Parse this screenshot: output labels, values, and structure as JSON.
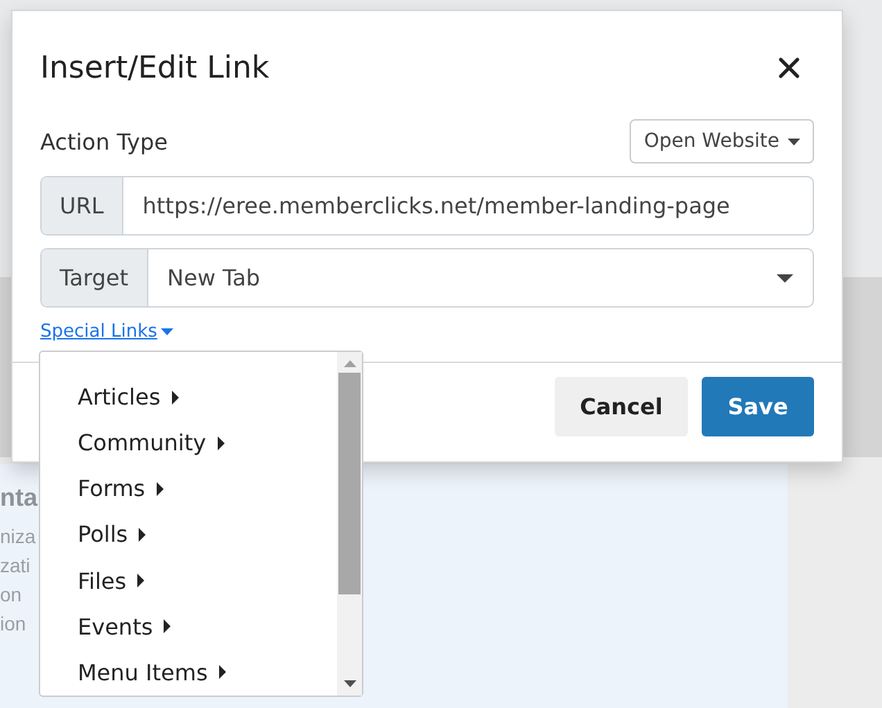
{
  "background": {
    "fragments": [
      "nta",
      "niza",
      "zati",
      "on",
      "ion"
    ]
  },
  "dialog": {
    "title": "Insert/Edit Link",
    "action_type": {
      "label": "Action Type",
      "value": "Open Website"
    },
    "url": {
      "addon": "URL",
      "value": "https://eree.memberclicks.net/member-landing-page"
    },
    "target": {
      "addon": "Target",
      "value": "New Tab"
    },
    "special_links": {
      "label": "Special Links",
      "expanded": true
    },
    "buttons": [
      {
        "label": "Cancel",
        "kind": "secondary"
      },
      {
        "label": "Save",
        "kind": "primary"
      }
    ]
  },
  "special_links_menu": {
    "items": [
      "Articles",
      "Community",
      "Forms",
      "Polls",
      "Files",
      "Events",
      "Menu Items"
    ]
  }
}
